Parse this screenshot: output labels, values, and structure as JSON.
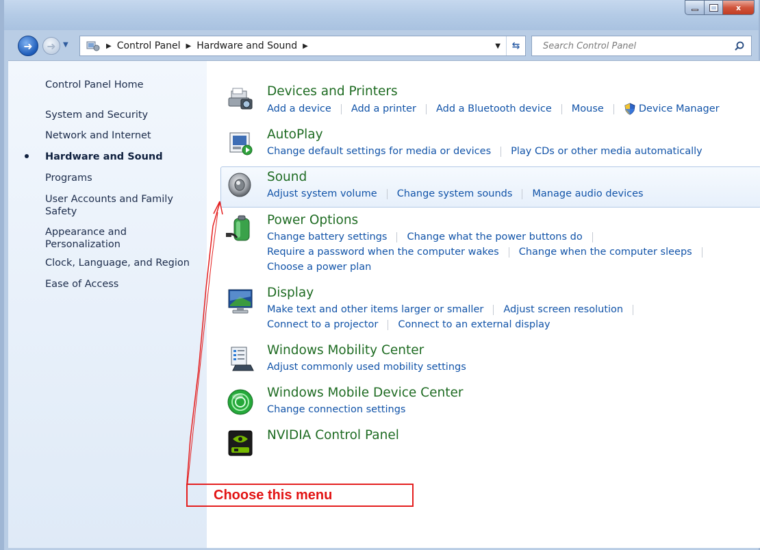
{
  "window": {
    "controls": {
      "minimize": "",
      "maximize": "",
      "close": "x"
    }
  },
  "navbar": {
    "breadcrumbs": [
      "Control Panel",
      "Hardware and Sound"
    ],
    "search_placeholder": "Search Control Panel"
  },
  "sidebar": {
    "items": [
      {
        "label": "Control Panel Home"
      },
      {
        "label": "System and Security"
      },
      {
        "label": "Network and Internet"
      },
      {
        "label": "Hardware and Sound",
        "active": true
      },
      {
        "label": "Programs"
      },
      {
        "label": "User Accounts and Family Safety"
      },
      {
        "label": "Appearance and Personalization"
      },
      {
        "label": "Clock, Language, and Region"
      },
      {
        "label": "Ease of Access"
      }
    ]
  },
  "categories": [
    {
      "title": "Devices and Printers",
      "icon": "printer-camera-icon",
      "links": [
        "Add a device",
        "Add a printer",
        "Add a Bluetooth device",
        "Mouse",
        "Device Manager"
      ]
    },
    {
      "title": "AutoPlay",
      "icon": "autoplay-icon",
      "links": [
        "Change default settings for media or devices",
        "Play CDs or other media automatically"
      ]
    },
    {
      "title": "Sound",
      "icon": "speaker-icon",
      "links": [
        "Adjust system volume",
        "Change system sounds",
        "Manage audio devices"
      ]
    },
    {
      "title": "Power Options",
      "icon": "battery-icon",
      "links": [
        "Change battery settings",
        "Change what the power buttons do",
        "Require a password when the computer wakes",
        "Change when the computer sleeps",
        "Choose a power plan"
      ]
    },
    {
      "title": "Display",
      "icon": "monitor-icon",
      "links": [
        "Make text and other items larger or smaller",
        "Adjust screen resolution",
        "Connect to a projector",
        "Connect to an external display"
      ]
    },
    {
      "title": "Windows Mobility Center",
      "icon": "mobility-center-icon",
      "links": [
        "Adjust commonly used mobility settings"
      ]
    },
    {
      "title": "Windows Mobile Device Center",
      "icon": "sync-icon",
      "links": [
        "Change connection settings"
      ]
    },
    {
      "title": "NVIDIA Control Panel",
      "icon": "nvidia-icon",
      "links": []
    }
  ],
  "annotation": {
    "text": "Choose this menu",
    "color": "#e21313"
  },
  "colors": {
    "category_title": "#1e6b22",
    "link": "#1153a8",
    "sidebar_text": "#1b2b4a"
  }
}
